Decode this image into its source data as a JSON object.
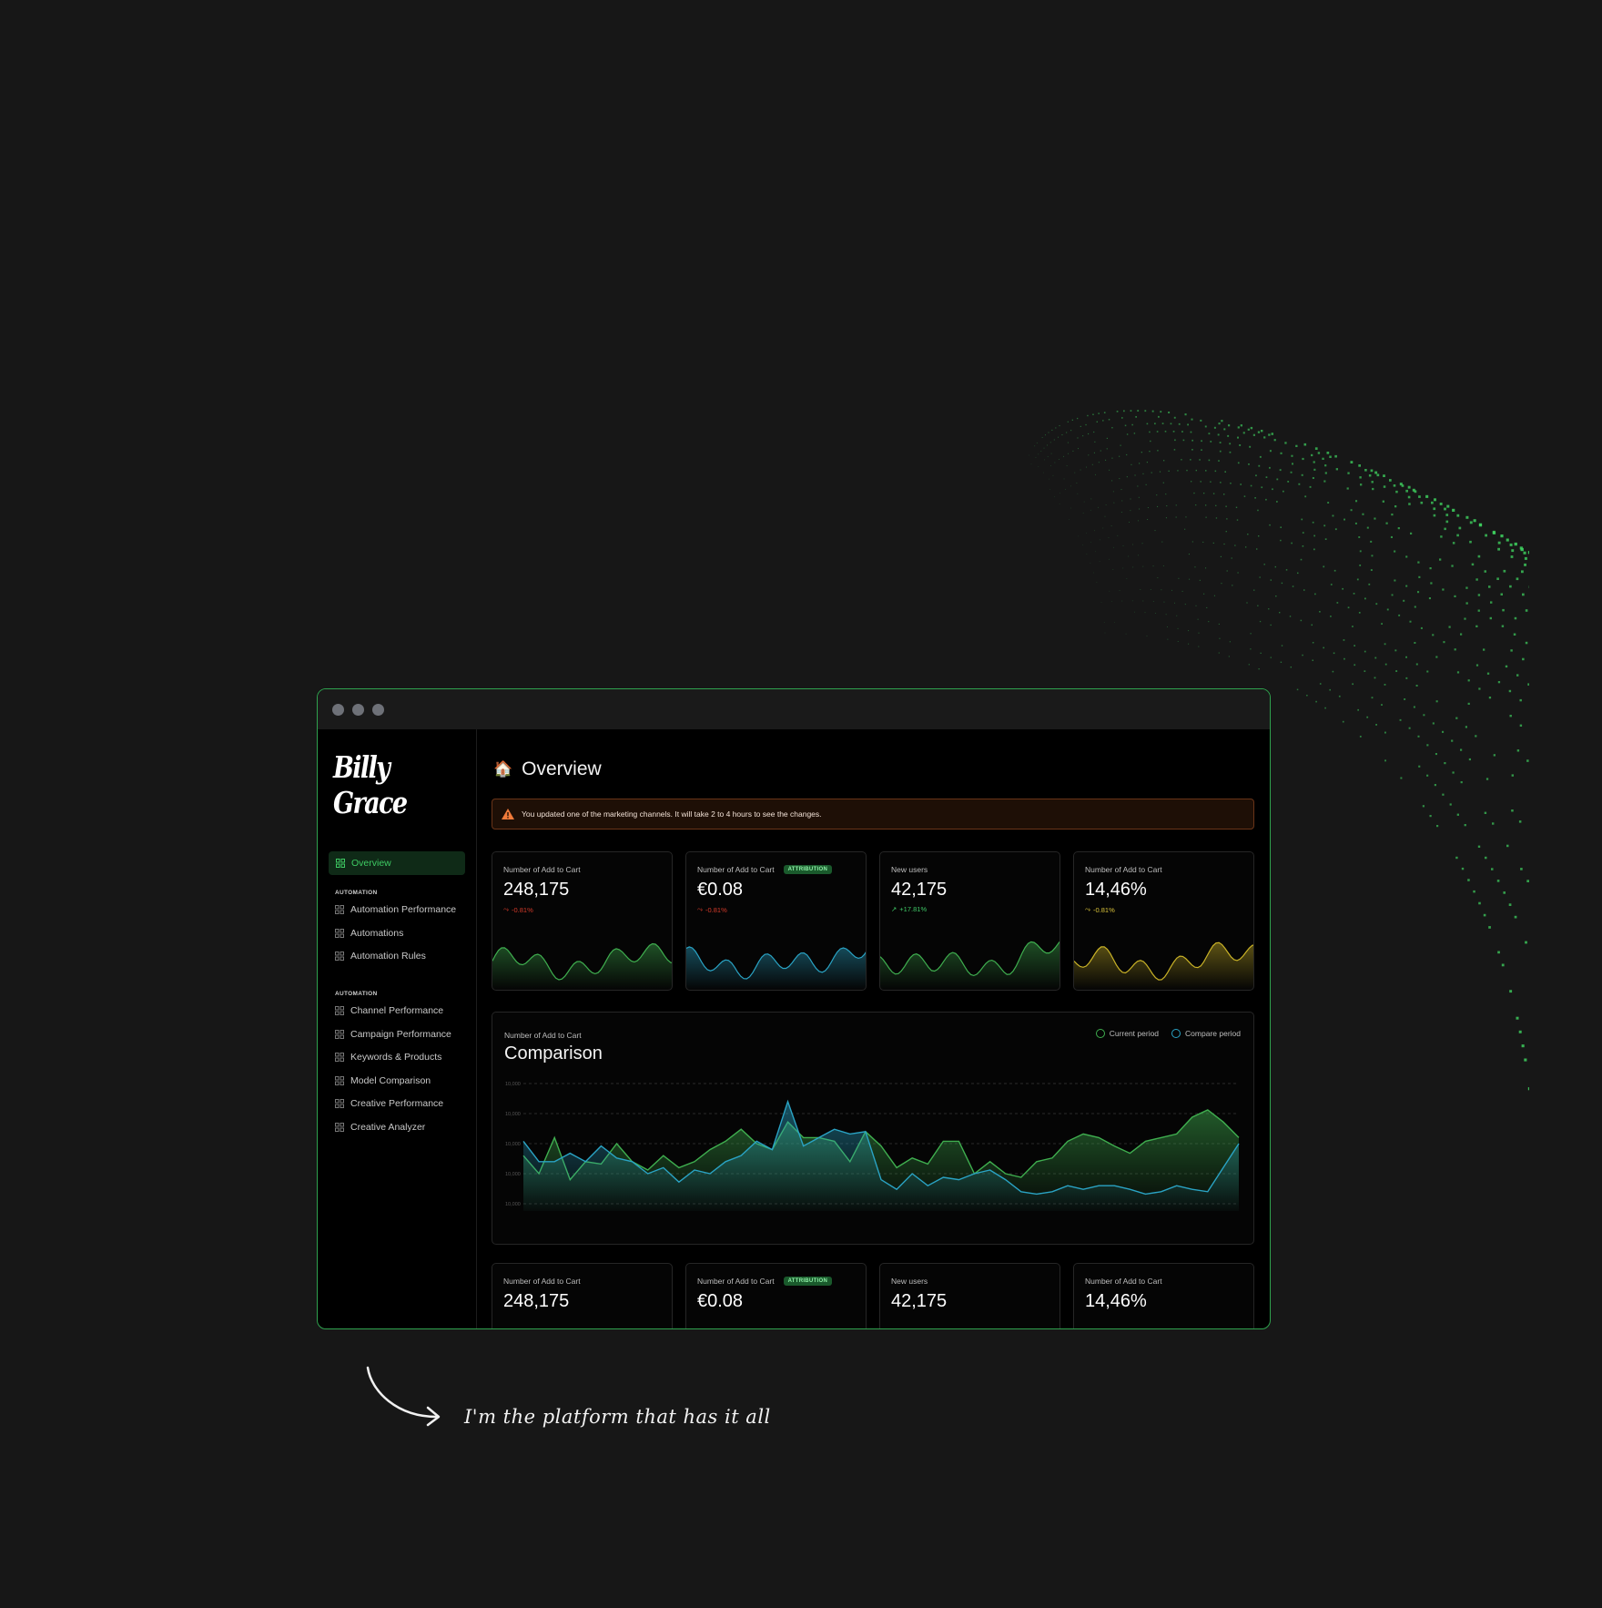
{
  "brand": {
    "logo_text": "Billy Grace"
  },
  "window": {
    "controls": [
      "close",
      "minimize",
      "maximize"
    ]
  },
  "sidebar": {
    "active_item": {
      "label": "Overview",
      "icon": "grid-icon"
    },
    "sections": [
      {
        "heading": "AUTOMATION",
        "items": [
          "Automation Performance",
          "Automations",
          "Automation Rules"
        ]
      },
      {
        "heading": "AUTOMATION",
        "items": [
          "Channel Performance",
          "Campaign Performance",
          "Keywords & Products",
          "Model Comparison",
          "Creative Performance",
          "Creative Analyzer"
        ]
      }
    ]
  },
  "header": {
    "title": "Overview",
    "icon": "house-icon"
  },
  "alert": {
    "text": "You updated one of the marketing channels. It will take 2 to 4 hours to see the changes.",
    "icon": "warning-icon"
  },
  "metric_cards": [
    {
      "label": "Number of Add to Cart",
      "badge": "",
      "value": "248,175",
      "delta": "-0.81%",
      "trend": "down",
      "color": "#3fae4f",
      "delta_color": "#d43a2a"
    },
    {
      "label": "Number of Add to Cart",
      "badge": "ATTRIBUTION",
      "value": "€0.08",
      "delta": "-0.81%",
      "trend": "down",
      "color": "#2aa3c4",
      "delta_color": "#d43a2a"
    },
    {
      "label": "New users",
      "badge": "",
      "value": "42,175",
      "delta": "+17.81%",
      "trend": "up",
      "color": "#3fae4f",
      "delta_color": "#3fc766"
    },
    {
      "label": "Number of Add to Cart",
      "badge": "",
      "value": "14,46%",
      "delta": "-0.81%",
      "trend": "down",
      "color": "#c9b227",
      "delta_color": "#d9c23a"
    }
  ],
  "metric_cards_bottom": [
    {
      "label": "Number of Add to Cart",
      "badge": "",
      "value": "248,175"
    },
    {
      "label": "Number of Add to Cart",
      "badge": "ATTRIBUTION",
      "value": "€0.08"
    },
    {
      "label": "New users",
      "badge": "",
      "value": "42,175"
    },
    {
      "label": "Number of Add to Cart",
      "badge": "",
      "value": "14,46%"
    }
  ],
  "comparison": {
    "label": "Number of Add to Cart",
    "title": "Comparison"
  },
  "chart_data": {
    "type": "area",
    "title": "Comparison",
    "y_ticks": [
      "10,000",
      "10,000",
      "10,000",
      "10,000",
      "10,000"
    ],
    "series": [
      {
        "name": "Current period",
        "color": "#3fae4f",
        "values": [
          40,
          25,
          55,
          20,
          35,
          33,
          50,
          35,
          28,
          40,
          30,
          35,
          45,
          52,
          62,
          50,
          45,
          68,
          55,
          55,
          52,
          35,
          60,
          48,
          30,
          38,
          33,
          52,
          52,
          25,
          35,
          25,
          22,
          35,
          38,
          52,
          58,
          55,
          48,
          42,
          52,
          55,
          58,
          72,
          78,
          68,
          55
        ]
      },
      {
        "name": "Compare period",
        "color": "#2aa3c4",
        "values": [
          52,
          35,
          35,
          42,
          35,
          48,
          38,
          35,
          25,
          30,
          18,
          28,
          25,
          35,
          40,
          52,
          45,
          85,
          48,
          55,
          62,
          58,
          60,
          20,
          12,
          25,
          15,
          22,
          20,
          25,
          28,
          20,
          10,
          8,
          10,
          15,
          12,
          15,
          15,
          12,
          8,
          10,
          15,
          12,
          10,
          30,
          50
        ]
      }
    ]
  },
  "caption": "I'm the platform that has it all"
}
